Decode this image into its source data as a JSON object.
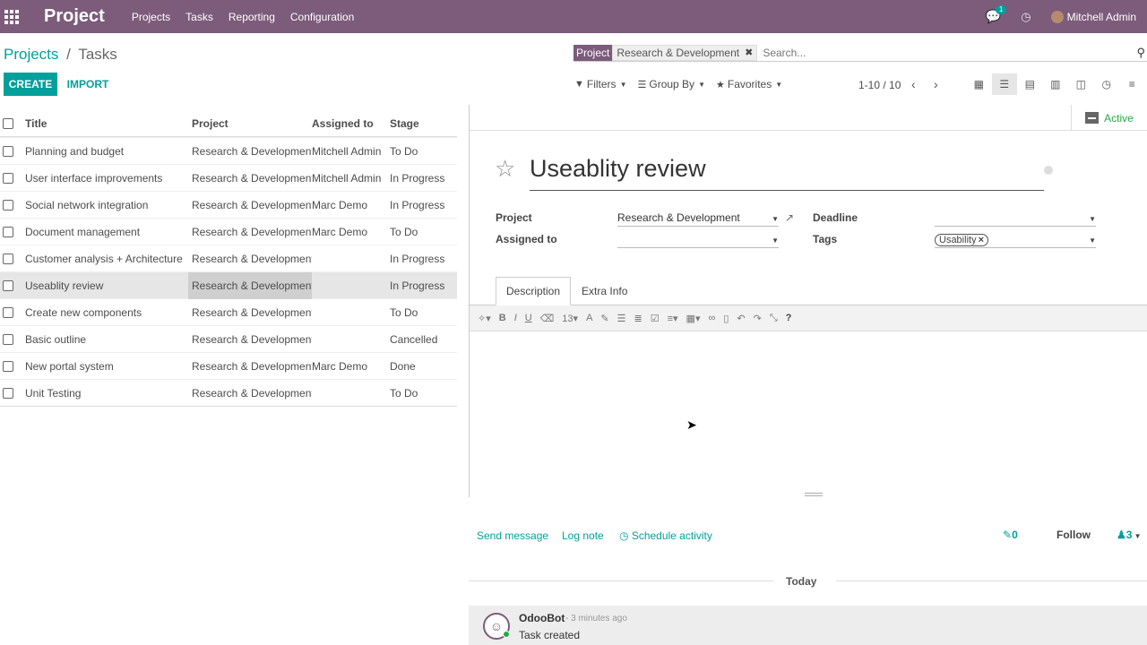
{
  "navbar": {
    "brand": "Project",
    "menu": [
      "Projects",
      "Tasks",
      "Reporting",
      "Configuration"
    ],
    "chat_count": "1",
    "user_name": "Mitchell Admin",
    "bg_color": "#7c5b7b"
  },
  "breadcrumb": {
    "parent": "Projects",
    "separator": "/",
    "current": "Tasks"
  },
  "actions": {
    "create": "CREATE",
    "import": "IMPORT"
  },
  "search": {
    "facet_label": "Project",
    "facet_value": "Research & Development",
    "placeholder": "Search..."
  },
  "filters": {
    "filters": "Filters",
    "group_by": "Group By",
    "favorites": "Favorites"
  },
  "pager": {
    "value": "1-10 / 10"
  },
  "views": [
    "kanban-icon",
    "list-icon",
    "calendar-icon",
    "pivot-icon",
    "graph-icon",
    "activity-icon",
    "gantt-icon"
  ],
  "list": {
    "headers": {
      "title": "Title",
      "project": "Project",
      "assigned": "Assigned to",
      "stage": "Stage"
    },
    "rows": [
      {
        "title": "Planning and budget",
        "project": "Research & Development",
        "assigned": "Mitchell Admin",
        "stage": "To Do"
      },
      {
        "title": "User interface improvements",
        "project": "Research & Development",
        "assigned": "Mitchell Admin",
        "stage": "In Progress"
      },
      {
        "title": "Social network integration",
        "project": "Research & Development",
        "assigned": "Marc Demo",
        "stage": "In Progress"
      },
      {
        "title": "Document management",
        "project": "Research & Development",
        "assigned": "Marc Demo",
        "stage": "To Do"
      },
      {
        "title": "Customer analysis + Architecture",
        "project": "Research & Development",
        "assigned": "",
        "stage": "In Progress"
      },
      {
        "title": "Useablity review",
        "project": "Research & Development",
        "assigned": "",
        "stage": "In Progress"
      },
      {
        "title": "Create new components",
        "project": "Research & Development",
        "assigned": "",
        "stage": "To Do"
      },
      {
        "title": "Basic outline",
        "project": "Research & Development",
        "assigned": "",
        "stage": "Cancelled"
      },
      {
        "title": "New portal system",
        "project": "Research & Development",
        "assigned": "Marc Demo",
        "stage": "Done"
      },
      {
        "title": "Unit Testing",
        "project": "Research & Development",
        "assigned": "",
        "stage": "To Do"
      }
    ]
  },
  "form": {
    "status_button": "Active",
    "title": "Useablity review",
    "fields": {
      "project_label": "Project",
      "project_value": "Research & Development",
      "assigned_label": "Assigned to",
      "assigned_value": "",
      "deadline_label": "Deadline",
      "deadline_value": "",
      "tags_label": "Tags",
      "tag": "Usability"
    },
    "tabs": [
      "Description",
      "Extra Info"
    ],
    "font_size": "13"
  },
  "chatter": {
    "send_message": "Send message",
    "log_note": "Log note",
    "schedule_activity": "Schedule activity",
    "attachments": "0",
    "follow": "Follow",
    "followers": "3",
    "today": "Today",
    "message": {
      "author": "OdooBot",
      "time": "- 3 minutes ago",
      "body": "Task created"
    }
  }
}
